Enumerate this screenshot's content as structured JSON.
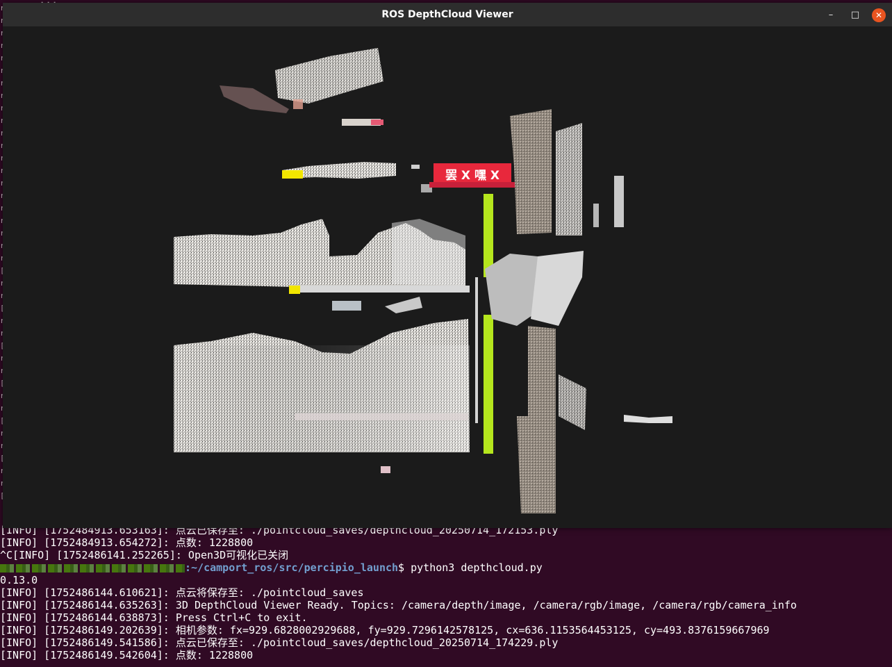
{
  "terminal": {
    "top_peek": "    ...",
    "lines": [
      {
        "text": "[INFO] [1752484913.653163]: 点云已保存至: ./pointcloud_saves/depthcloud_20250714_172153.ply"
      },
      {
        "text": "[INFO] [1752484913.654272]: 点数: 1228800"
      },
      {
        "text": "^C[INFO] [1752486141.252265]: Open3D可视化已关闭"
      },
      {
        "prompt": {
          "path": ":~/camport_ros/src/percipio_launch",
          "symbol": "$ ",
          "command": "python3 depthcloud.py"
        }
      },
      {
        "text": "0.13.0"
      },
      {
        "text": "[INFO] [1752486144.610621]: 点云将保存至: ./pointcloud_saves"
      },
      {
        "text": "[INFO] [1752486144.635263]: 3D DepthCloud Viewer Ready. Topics: /camera/depth/image, /camera/rgb/image, /camera/rgb/camera_info"
      },
      {
        "text": "[INFO] [1752486144.638873]: Press Ctrl+C to exit."
      },
      {
        "text": "[INFO] [1752486149.202639]: 相机参数: fx=929.6828002929688, fy=929.7296142578125, cx=636.1153564453125, cy=493.8376159667969"
      },
      {
        "text": "[INFO] [1752486149.541586]: 点云已保存至: ./pointcloud_saves/depthcloud_20250714_174229.ply"
      },
      {
        "text": "[INFO] [1752486149.542604]: 点数: 1228800"
      }
    ]
  },
  "window": {
    "title": "ROS DepthCloud Viewer",
    "controls": {
      "minimize": "–",
      "maximize": "□",
      "close": "✕"
    },
    "sign_text": "罢 X 嘿 X",
    "colors": {
      "viewport_bg": "#1b1b1b",
      "cloud_white": "#e6e4e0",
      "cloud_gray": "#a39a90",
      "pole_green": "#b5e61d",
      "sign_red": "#e8283c",
      "accent_yellow": "#f2e600"
    }
  }
}
